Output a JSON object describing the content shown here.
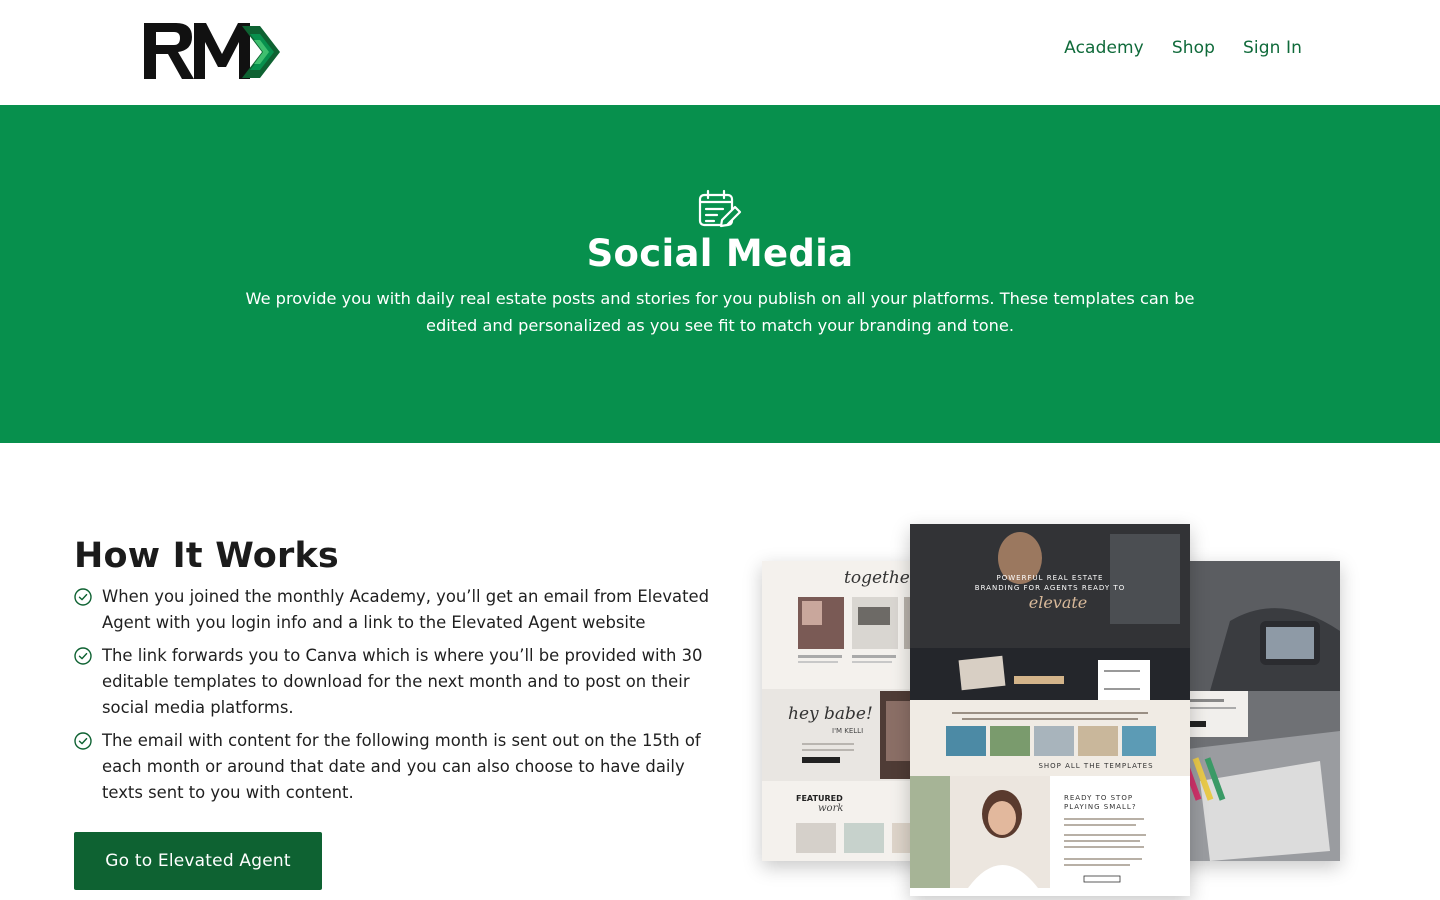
{
  "brand": {
    "logo_letters": "RM",
    "accent": "#07904d",
    "dark_green": "#0e6232"
  },
  "nav": {
    "items": [
      "Academy",
      "Shop",
      "Sign In"
    ]
  },
  "hero": {
    "icon": "calendar-edit-icon",
    "title": "Social Media",
    "description": "We provide you with daily real estate posts and stories for you publish on all your platforms. These templates can be edited and personalized as you see fit to match your branding and tone."
  },
  "how": {
    "title": "How It Works",
    "steps": [
      "When you joined the monthly Academy, you’ll get an email from Elevated Agent with you login info and a link to the Elevated Agent website",
      "The link forwards you to Canva which is where you’ll be provided with 30 editable templates to download for the next month and to post on their social media platforms.",
      "The email with content for the following month is sent out on the 15th of each month or around that date and you can also choose to have daily texts sent to you with content."
    ],
    "cta_label": "Go to Elevated Agent"
  },
  "mockup": {
    "left_headline": "together!",
    "left_greeting": "hey babe!",
    "left_name": "I'M KELLI",
    "left_featured": "FEATURED",
    "left_work": "work",
    "center_hero_line1": "POWERFUL REAL ESTATE",
    "center_hero_line2": "BRANDING FOR AGENTS READY TO",
    "center_hero_script": "elevate",
    "center_cta": "SHOP ALL THE TEMPLATES",
    "center_ready_line1": "READY TO STOP",
    "center_ready_line2": "PLAYING SMALL?"
  }
}
